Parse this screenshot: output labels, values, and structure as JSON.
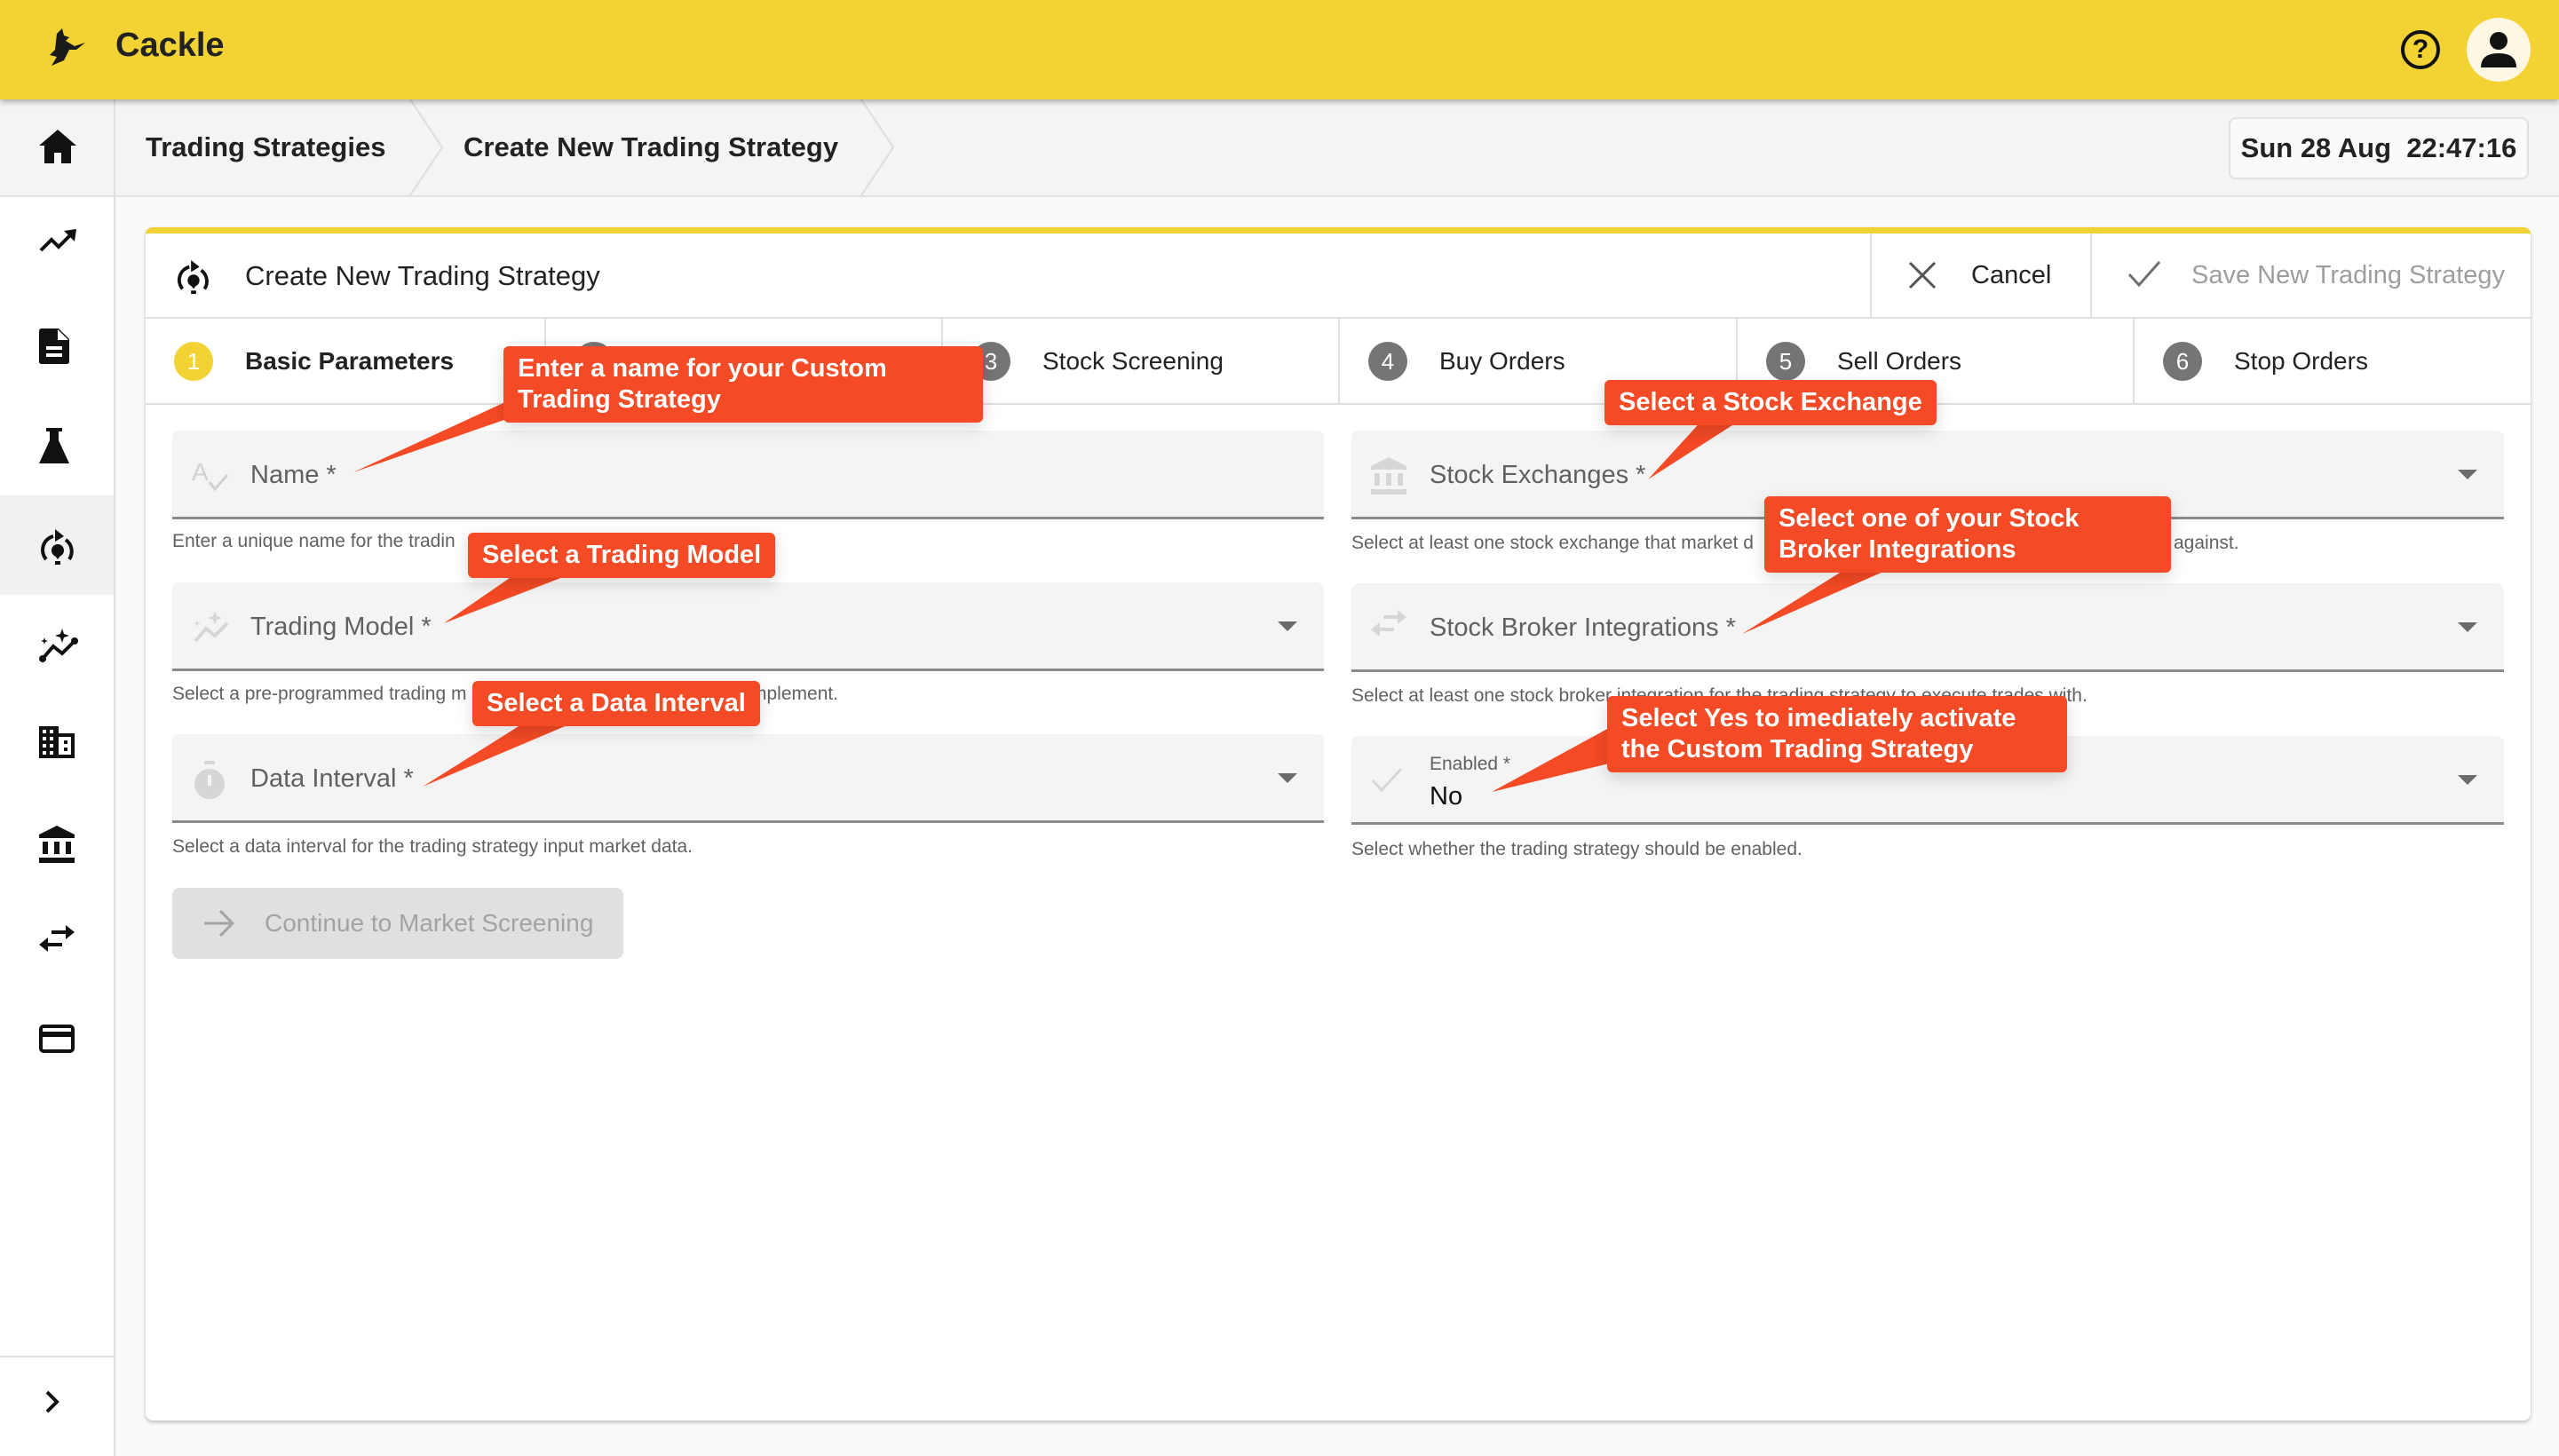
{
  "app": {
    "title": "Cackle",
    "brand_color": "#F2D333",
    "callout_color": "#F44A25"
  },
  "topbar": {
    "help_icon": "help-circle-icon",
    "help_glyph": "?",
    "account_icon": "account-icon"
  },
  "breadcrumb": {
    "items": [
      {
        "label": "Trading Strategies"
      },
      {
        "label": "Create New Trading Strategy"
      }
    ]
  },
  "clock": {
    "text": "Sun 28 Aug  22:47:16"
  },
  "sidebar": {
    "items": [
      {
        "icon": "home-icon"
      },
      {
        "icon": "trending-up-icon"
      },
      {
        "icon": "document-icon"
      },
      {
        "icon": "flask-icon"
      },
      {
        "icon": "strategy-lightbulb-cycle-icon",
        "active": true
      },
      {
        "icon": "ai-chart-sparkle-icon"
      },
      {
        "icon": "building-icon"
      },
      {
        "icon": "bank-icon"
      },
      {
        "icon": "swap-arrows-icon"
      },
      {
        "icon": "credit-card-icon"
      }
    ],
    "expand_icon": "chevron-right-icon"
  },
  "card": {
    "title": "Create New Trading Strategy",
    "cancel_label": "Cancel",
    "save_label": "Save New Trading Strategy",
    "steps": [
      {
        "number": "1",
        "label": "Basic Parameters",
        "active": true
      },
      {
        "number": "2",
        "label": ""
      },
      {
        "number": "3",
        "label": "Stock Screening"
      },
      {
        "number": "4",
        "label": "Buy Orders"
      },
      {
        "number": "5",
        "label": "Sell Orders"
      },
      {
        "number": "6",
        "label": "Stop Orders"
      }
    ]
  },
  "form": {
    "name": {
      "label": "Name *",
      "value": "",
      "helper": "Enter a unique name for the tradin"
    },
    "trading_model": {
      "label": "Trading Model *",
      "value": "",
      "helper_left": "Select a pre-programmed trading m",
      "helper_right": "mplement."
    },
    "data_interval": {
      "label": "Data Interval *",
      "value": "",
      "helper": "Select a data interval for the trading strategy input market data."
    },
    "stock_exchanges": {
      "label": "Stock Exchanges *",
      "value": "",
      "helper_left": "Select at least one stock exchange that market d",
      "helper_right": "against."
    },
    "stock_broker_integrations": {
      "label": "Stock Broker Integrations *",
      "value": "",
      "helper": "Select at least one stock broker integration for the trading strategy to execute trades with."
    },
    "enabled": {
      "label": "Enabled *",
      "value": "No",
      "helper": "Select whether the trading strategy should be enabled."
    },
    "continue_label": "Continue to Market Screening"
  },
  "callouts": [
    {
      "id": "name",
      "text": "Enter a name for your Custom Trading Strategy"
    },
    {
      "id": "trading-model",
      "text": "Select a Trading Model"
    },
    {
      "id": "data-interval",
      "text": "Select a Data Interval"
    },
    {
      "id": "stock-exchange",
      "text": "Select a Stock Exchange"
    },
    {
      "id": "stock-broker",
      "text": "Select one of your Stock Broker Integrations"
    },
    {
      "id": "enabled",
      "text": "Select Yes to imediately activate the Custom Trading Strategy"
    }
  ]
}
